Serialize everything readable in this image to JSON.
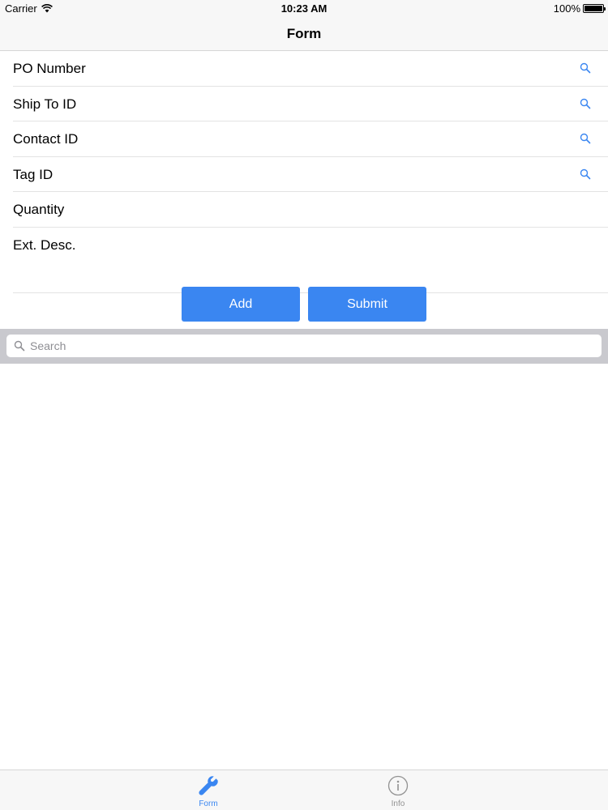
{
  "status_bar": {
    "carrier": "Carrier",
    "time": "10:23 AM",
    "battery": "100%",
    "battery_level": 1.0
  },
  "nav": {
    "title": "Form"
  },
  "form": {
    "rows": [
      {
        "label": "PO Number",
        "has_search": true
      },
      {
        "label": "Ship To ID",
        "has_search": true
      },
      {
        "label": "Contact ID",
        "has_search": true
      },
      {
        "label": "Tag ID",
        "has_search": true
      },
      {
        "label": "Quantity",
        "has_search": false
      },
      {
        "label": "Ext. Desc.",
        "has_search": false
      }
    ],
    "add_label": "Add",
    "submit_label": "Submit"
  },
  "search": {
    "placeholder": "Search",
    "value": ""
  },
  "tab_bar": {
    "tabs": [
      {
        "label": "Form",
        "icon": "wrench-icon",
        "selected": true
      },
      {
        "label": "Info",
        "icon": "info-icon",
        "selected": false
      }
    ]
  },
  "colors": {
    "accent": "#3a86f1",
    "inactive_tab": "#929292",
    "search_bar_bg": "#c9c9ce"
  }
}
